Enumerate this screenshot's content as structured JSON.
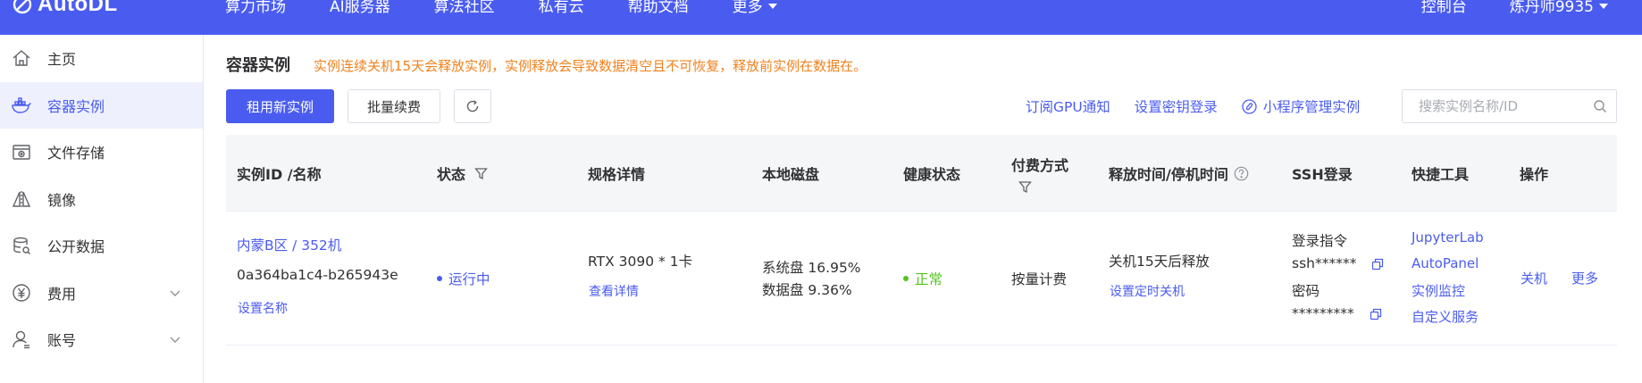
{
  "brand": {
    "name": "AutoDL",
    "color": "#4a5cf0"
  },
  "topnav": {
    "items": [
      "算力市场",
      "AI服务器",
      "算法社区",
      "私有云",
      "帮助文档",
      "更多"
    ],
    "console": "控制台",
    "user": "炼丹师9935"
  },
  "sidebar": {
    "items": [
      {
        "label": "主页",
        "icon": "home-icon"
      },
      {
        "label": "容器实例",
        "icon": "docker-icon"
      },
      {
        "label": "文件存储",
        "icon": "storage-icon"
      },
      {
        "label": "镜像",
        "icon": "image-icon"
      },
      {
        "label": "公开数据",
        "icon": "database-icon"
      },
      {
        "label": "费用",
        "icon": "currency-icon"
      },
      {
        "label": "账号",
        "icon": "user-icon"
      }
    ]
  },
  "page": {
    "title": "容器实例",
    "warning": "实例连续关机15天会释放实例，实例释放会导致数据清空且不可恢复，释放前实例在数据在。"
  },
  "toolbar": {
    "rent_new": "租用新实例",
    "batch_renew": "批量续费",
    "subscribe_gpu": "订阅GPU通知",
    "set_key_login": "设置密钥登录",
    "mini_program": "小程序管理实例",
    "search_placeholder": "搜索实例名称/ID"
  },
  "table": {
    "headers": {
      "id_name": "实例ID /名称",
      "status": "状态",
      "spec": "规格详情",
      "disk": "本地磁盘",
      "health": "健康状态",
      "billing": "付费方式",
      "release": "释放时间/停机时间",
      "ssh": "SSH登录",
      "tools": "快捷工具",
      "actions": "操作"
    },
    "rows": [
      {
        "region": "内蒙B区 / 352机",
        "id": "0a364ba1c4-b265943e",
        "set_name": "设置名称",
        "status": "运行中",
        "gpu": "RTX 3090 * 1卡",
        "view_details": "查看详情",
        "disk_system": "系统盘 16.95%",
        "disk_data": "数据盘 9.36%",
        "health": "正常",
        "billing": "按量计费",
        "release": "关机15天后释放",
        "set_shutdown": "设置定时关机",
        "ssh_cmd_label": "登录指令",
        "ssh_cmd": "ssh******",
        "pwd_label": "密码",
        "pwd": "*********",
        "tools": [
          "JupyterLab",
          "AutoPanel",
          "实例监控",
          "自定义服务"
        ],
        "actions": [
          "关机",
          "更多"
        ]
      }
    ]
  },
  "colors": {
    "accent": "#4a5cf0",
    "warning": "#f0821e",
    "success": "#52c41a"
  }
}
